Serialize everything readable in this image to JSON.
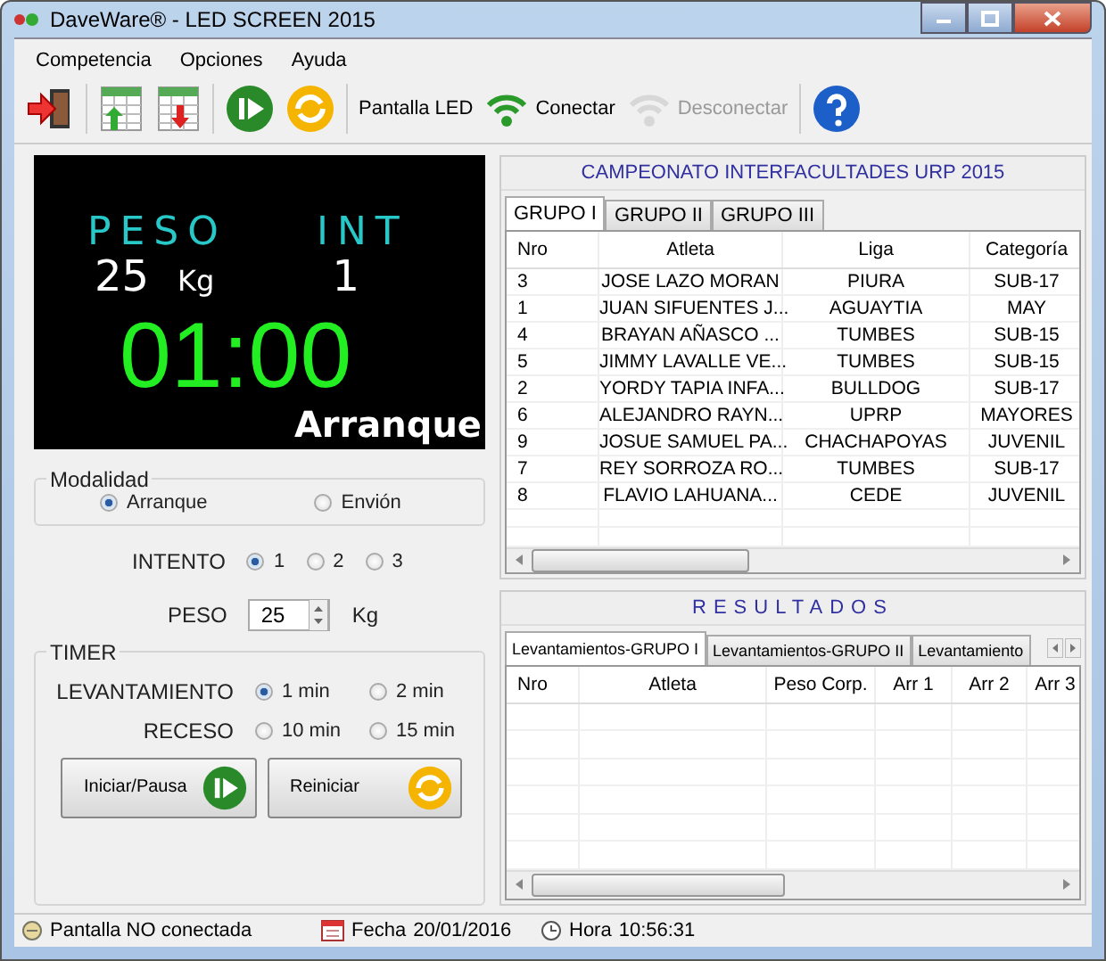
{
  "window": {
    "title": "DaveWare® - LED SCREEN 2015"
  },
  "menu": [
    "Competencia",
    "Opciones",
    "Ayuda"
  ],
  "toolbar": [
    [
      {
        "kind": "exit",
        "disabled": false
      }
    ],
    [
      {
        "kind": "import",
        "disabled": false
      },
      {
        "kind": "export",
        "disabled": false
      }
    ],
    [
      {
        "kind": "start",
        "disabled": false
      },
      {
        "kind": "reset",
        "disabled": false
      }
    ],
    [
      {
        "kind": "text",
        "label": "Pantalla LED",
        "disabled": false
      },
      {
        "kind": "connect",
        "label": "Conectar",
        "disabled": false
      },
      {
        "kind": "connect",
        "label": "Desconectar",
        "disabled": true
      }
    ],
    [
      {
        "kind": "help",
        "disabled": false
      }
    ]
  ],
  "display": {
    "peso_label": "PESO",
    "int_label": "INT",
    "weight": "25",
    "unit": "Kg",
    "attempt": "1",
    "timer": "01:00",
    "mode": "Arranque"
  },
  "modalidad": {
    "legend": "Modalidad",
    "options": [
      {
        "label": "Arranque",
        "selected": true
      },
      {
        "label": "Envión",
        "selected": false
      }
    ]
  },
  "intento": {
    "label": "INTENTO",
    "options": [
      {
        "label": "1",
        "selected": true
      },
      {
        "label": "2",
        "selected": false
      },
      {
        "label": "3",
        "selected": false
      }
    ]
  },
  "peso": {
    "label": "PESO",
    "value": "25",
    "unit": "Kg"
  },
  "timer": {
    "legend": "TIMER",
    "rows": [
      {
        "label": "LEVANTAMIENTO",
        "options": [
          {
            "label": "1 min",
            "selected": true
          },
          {
            "label": "2 min",
            "selected": false
          }
        ]
      },
      {
        "label": "RECESO",
        "options": [
          {
            "label": "10 min",
            "selected": false
          },
          {
            "label": "15 min",
            "selected": false
          }
        ]
      }
    ],
    "buttons": [
      {
        "label": "Iniciar/Pausa",
        "kind": "start"
      },
      {
        "label": "Reiniciar",
        "kind": "reset"
      }
    ]
  },
  "competition": {
    "title": "CAMPEONATO INTERFACULTADES URP 2015",
    "tabs": [
      {
        "label": "GRUPO I",
        "selected": true
      },
      {
        "label": "GRUPO II",
        "selected": false
      },
      {
        "label": "GRUPO III",
        "selected": false
      }
    ],
    "columns": [
      "Nro",
      "Atleta",
      "Liga",
      "Categoría"
    ],
    "rows": [
      [
        "3",
        "JOSE LAZO MORAN",
        "PIURA",
        "SUB-17"
      ],
      [
        "1",
        "JUAN SIFUENTES J...",
        "AGUAYTIA",
        "MAY"
      ],
      [
        "4",
        "BRAYAN AÑASCO ...",
        "TUMBES",
        "SUB-15"
      ],
      [
        "5",
        "JIMMY LAVALLE VE...",
        "TUMBES",
        "SUB-15"
      ],
      [
        "2",
        "YORDY TAPIA INFA...",
        "BULLDOG",
        "SUB-17"
      ],
      [
        "6",
        "ALEJANDRO RAYN...",
        "UPRP",
        "MAYORES"
      ],
      [
        "9",
        "JOSUE SAMUEL PA...",
        "CHACHAPOYAS",
        "JUVENIL"
      ],
      [
        "7",
        "REY SORROZA RO...",
        "TUMBES",
        "SUB-17"
      ],
      [
        "8",
        "FLAVIO LAHUANA...",
        "CEDE",
        "JUVENIL"
      ]
    ]
  },
  "results": {
    "title": "RESULTADOS",
    "tabs": [
      {
        "label": "Levantamientos-GRUPO I",
        "selected": true
      },
      {
        "label": "Levantamientos-GRUPO II",
        "selected": false
      },
      {
        "label": "Levantamiento",
        "selected": false
      }
    ],
    "columns": [
      "Nro",
      "Atleta",
      "Peso Corp.",
      "Arr 1",
      "Arr 2",
      "Arr 3"
    ]
  },
  "status_bar": {
    "connection": "Pantalla NO conectada",
    "date_label": "Fecha",
    "date": "20/01/2016",
    "time_label": "Hora",
    "time": "10:56:31"
  }
}
